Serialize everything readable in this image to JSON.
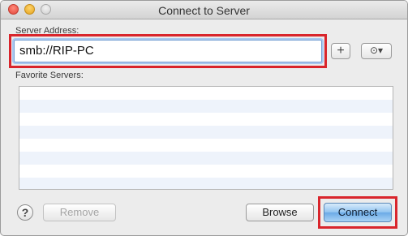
{
  "window": {
    "title": "Connect to Server"
  },
  "server": {
    "label": "Server Address:",
    "value": "smb://RIP-PC",
    "add_label": "+",
    "recent_label": "⊙▾"
  },
  "favorites": {
    "label": "Favorite Servers:",
    "rows": [
      "",
      "",
      "",
      "",
      "",
      "",
      "",
      ""
    ]
  },
  "footer": {
    "help_label": "?",
    "remove_label": "Remove",
    "browse_label": "Browse",
    "connect_label": "Connect"
  },
  "colors": {
    "highlight": "#d9252c",
    "accent": "#6aaae6"
  }
}
